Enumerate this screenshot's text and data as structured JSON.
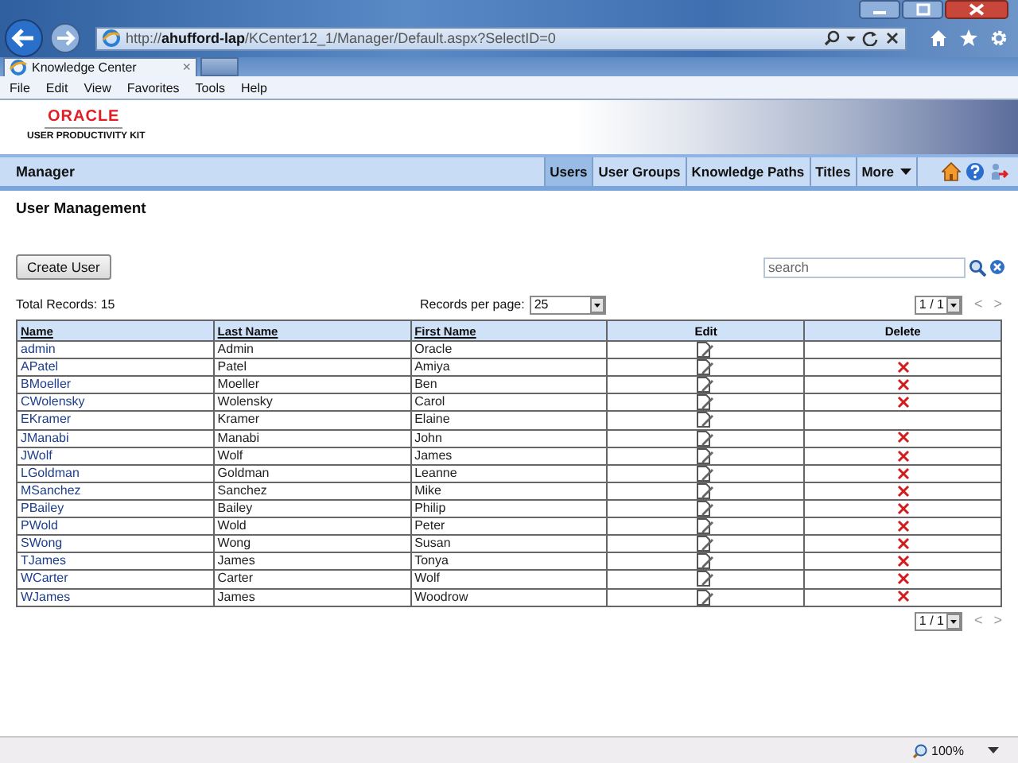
{
  "browser": {
    "address": "http://**ahufford-lap**/KCenter12_1/Manager/Default.aspx?SelectID=0",
    "tabs": [
      {
        "label": "Knowledge Center",
        "close": "×",
        "selected": true
      }
    ],
    "menu": [
      "File",
      "Edit",
      "View",
      "Favorites",
      "Tools",
      "Help"
    ]
  },
  "logo": {
    "brand": "ORACLE",
    "product": "USER PRODUCTIVITY KIT"
  },
  "app_bar": {
    "title": "Manager",
    "nav": [
      {
        "label": "Users",
        "kind": "link",
        "selected": true
      },
      {
        "label": "User Groups",
        "kind": "link",
        "selected": false
      },
      {
        "label": "Knowledge Paths",
        "kind": "link",
        "selected": false
      },
      {
        "label": "Titles",
        "kind": "link",
        "selected": false
      },
      {
        "label": "More",
        "kind": "menu",
        "selected": false
      }
    ]
  },
  "page": {
    "heading": "User Management",
    "create_button": "Create User",
    "search": {
      "placeholder": "search"
    },
    "total_records": "Total Records: 15",
    "per_page_label": "Records per page:",
    "per_page_value": "25",
    "pager_top": {
      "value": "1 / 1",
      "prev": "<",
      "next": ">",
      "disabled": true
    },
    "pager_bottom": {
      "value": "1 / 1",
      "prev": "<",
      "next": ">",
      "disabled": true
    }
  },
  "table": {
    "columns": [
      {
        "label": "Name",
        "kind": "sort"
      },
      {
        "label": "Last Name",
        "kind": "sort"
      },
      {
        "label": "First Name",
        "kind": "sort"
      },
      {
        "label": "Edit",
        "kind": "action"
      },
      {
        "label": "Delete",
        "kind": "action"
      }
    ],
    "rows": [
      {
        "name": "admin",
        "last_name": "Admin",
        "first_name": "Oracle",
        "deletable": false
      },
      {
        "name": "APatel",
        "last_name": "Patel",
        "first_name": "Amiya",
        "deletable": true
      },
      {
        "name": "BMoeller",
        "last_name": "Moeller",
        "first_name": "Ben",
        "deletable": true
      },
      {
        "name": "CWolensky",
        "last_name": "Wolensky",
        "first_name": "Carol",
        "deletable": true
      },
      {
        "name": "EKramer",
        "last_name": "Kramer",
        "first_name": "Elaine",
        "deletable": false
      },
      {
        "name": "JManabi",
        "last_name": "Manabi",
        "first_name": "John",
        "deletable": true
      },
      {
        "name": "JWolf",
        "last_name": "Wolf",
        "first_name": "James",
        "deletable": true
      },
      {
        "name": "LGoldman",
        "last_name": "Goldman",
        "first_name": "Leanne",
        "deletable": true
      },
      {
        "name": "MSanchez",
        "last_name": "Sanchez",
        "first_name": "Mike",
        "deletable": true
      },
      {
        "name": "PBailey",
        "last_name": "Bailey",
        "first_name": "Philip",
        "deletable": true
      },
      {
        "name": "PWold",
        "last_name": "Wold",
        "first_name": "Peter",
        "deletable": true
      },
      {
        "name": "SWong",
        "last_name": "Wong",
        "first_name": "Susan",
        "deletable": true
      },
      {
        "name": "TJames",
        "last_name": "James",
        "first_name": "Tonya",
        "deletable": true
      },
      {
        "name": "WCarter",
        "last_name": "Carter",
        "first_name": "Wolf",
        "deletable": true
      },
      {
        "name": "WJames",
        "last_name": "James",
        "first_name": "Woodrow",
        "deletable": true
      }
    ]
  },
  "status_bar": {
    "zoom": "100%"
  }
}
